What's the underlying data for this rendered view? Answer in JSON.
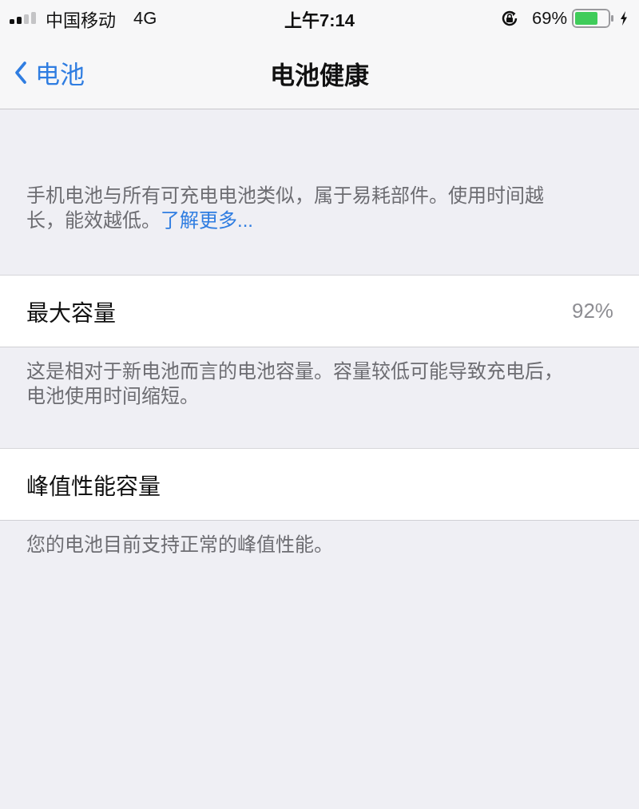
{
  "status_bar": {
    "carrier": "中国移动",
    "network": "4G",
    "time": "上午7:14",
    "orientation_lock": true,
    "battery_percent": "69%",
    "charging": true
  },
  "navigation": {
    "back_label": "电池",
    "title": "电池健康"
  },
  "intro": {
    "text": "手机电池与所有可充电电池类似，属于易耗部件。使用时间越长，能效越低。",
    "link": "了解更多..."
  },
  "sections": [
    {
      "label": "最大容量",
      "value": "92%",
      "footer": "这是相对于新电池而言的电池容量。容量较低可能导致充电后，电池使用时间缩短。"
    },
    {
      "label": "峰值性能容量",
      "footer": "您的电池目前支持正常的峰值性能。"
    }
  ]
}
